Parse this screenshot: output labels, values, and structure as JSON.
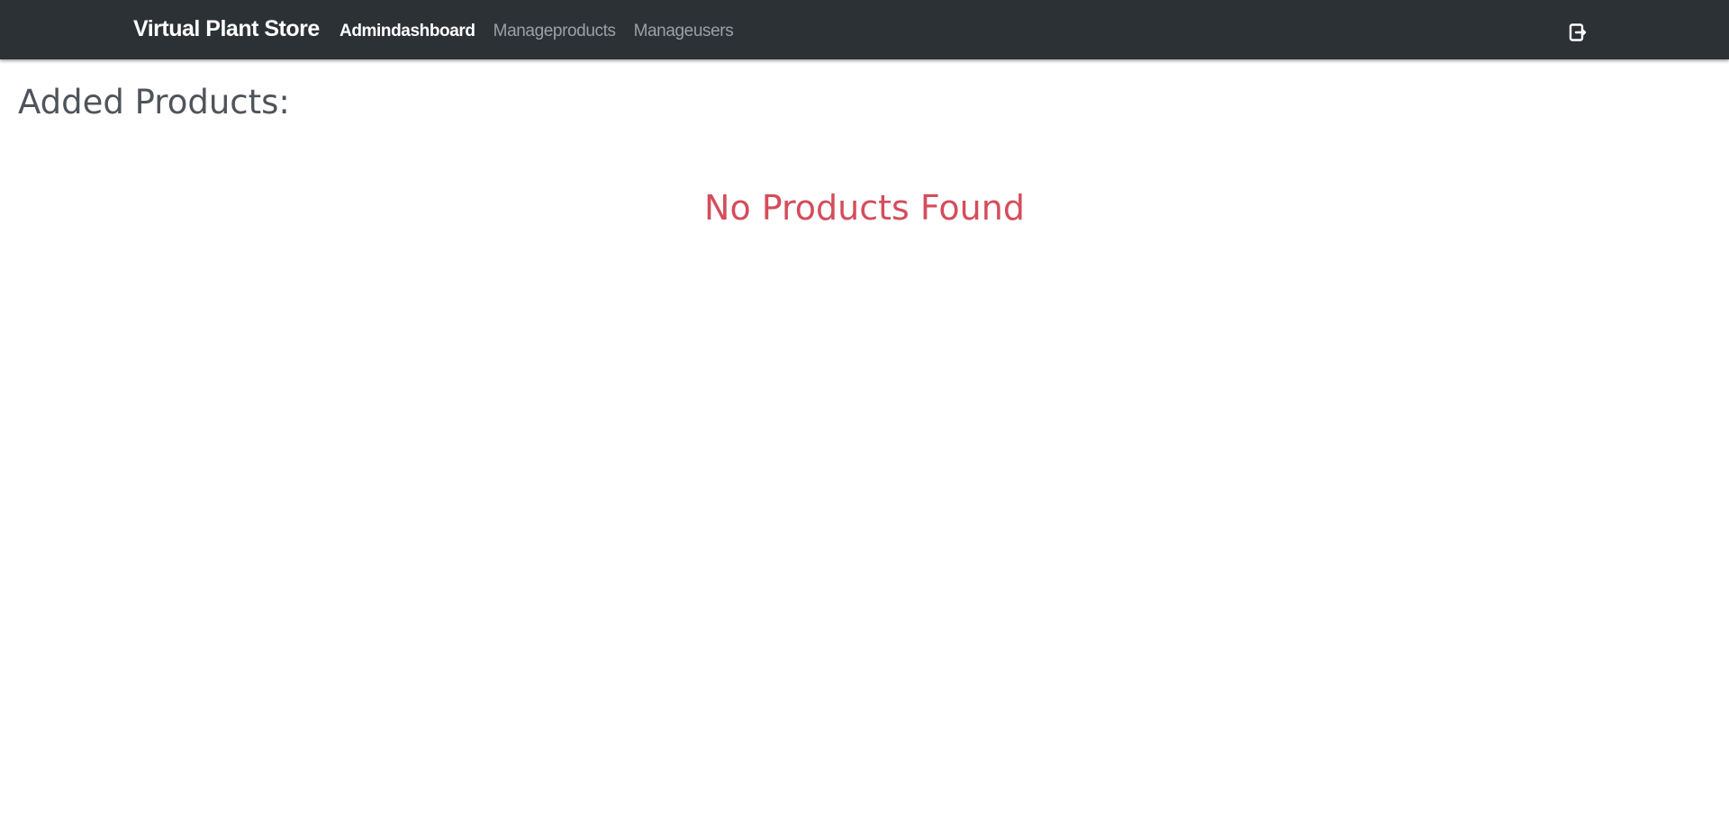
{
  "navbar": {
    "brand": "Virtual Plant Store",
    "links": [
      {
        "label": "Admindashboard",
        "active": true
      },
      {
        "label": "Manageproducts",
        "active": false
      },
      {
        "label": "Manageusers",
        "active": false
      }
    ],
    "logout_icon": "logout-icon"
  },
  "main": {
    "title": "Added Products:",
    "empty_message": "No Products Found"
  },
  "colors": {
    "navbar_background": "#2c3136",
    "active_link": "#ffffff",
    "inactive_link": "#9aa0a6",
    "title_text": "#4f545b",
    "empty_message": "#d44d5c"
  }
}
